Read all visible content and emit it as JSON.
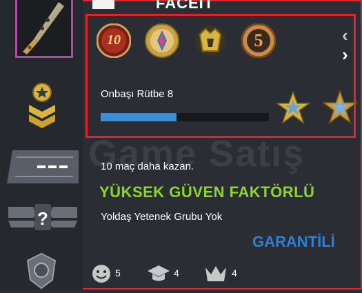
{
  "header": {
    "faceit_label": "FACEIT"
  },
  "rank": {
    "name": "Onbaşı Rütbe 8",
    "progress_percent": 45
  },
  "medals": [
    {
      "label": "10",
      "icon": "10-year-coin-icon"
    },
    {
      "label": "",
      "icon": "pin-coin-icon"
    },
    {
      "label": "",
      "icon": "operation-coin-icon"
    },
    {
      "label": "5",
      "icon": "5-year-coin-icon"
    }
  ],
  "wins": {
    "text": "10 maç daha kazan."
  },
  "trust": {
    "text": "YÜKSEK GÜVEN FAKTÖRLÜ"
  },
  "skill_group": {
    "text": "Yoldaş Yetenek Grubu Yok"
  },
  "guarantee": {
    "text": "GARANTİLİ"
  },
  "watermark": {
    "text": "Game Satış"
  },
  "stats": {
    "friendly": "5",
    "teacher": "4",
    "leader": "4"
  },
  "colors": {
    "frame": "#e8202a",
    "trust": "#8fd62a",
    "guarantee": "#2f7fd6",
    "progress": "#3a8fd6",
    "skin_border": "#b04aa8"
  }
}
